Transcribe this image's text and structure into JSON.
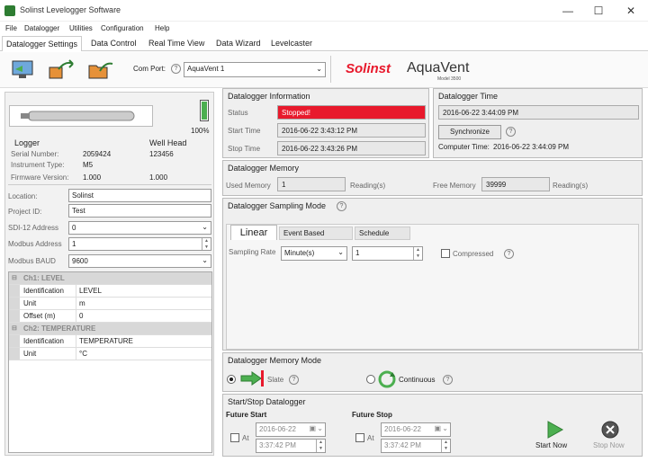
{
  "window": {
    "title": "Solinst Levelogger Software",
    "minimize": "—",
    "maximize": "☐",
    "close": "✕"
  },
  "menu": [
    "File",
    "Datalogger",
    "Utilities",
    "Configuration",
    "Help"
  ],
  "tabs": [
    "Datalogger Settings",
    "Data Control",
    "Real Time View",
    "Data Wizard",
    "Levelcaster"
  ],
  "toolbar": {
    "com_port_label": "Com Port:",
    "help": "?",
    "com_port_value": "AquaVent 1",
    "logo_solinst": "Solinst",
    "logo_aquavent": "AquaVent",
    "logo_sub": "Model 3500"
  },
  "device": {
    "battery_pct": "100%",
    "battery_level": 1.0
  },
  "logger": {
    "head_logger": "Logger",
    "head_well": "Well Head",
    "serial_label": "Serial Number:",
    "serial": "2059424",
    "serial_well": "123456",
    "instrument_label": "Instrument Type:",
    "instrument": "M5",
    "firmware_label": "Firmware Version:",
    "firmware": "1.000",
    "firmware_well": "1.000"
  },
  "fields": {
    "location_label": "Location:",
    "location": "Solinst",
    "project_label": "Project ID:",
    "project": "Test",
    "sdi_label": "SDI-12 Address",
    "sdi": "0",
    "modbus_label": "Modbus Address",
    "modbus": "1",
    "baud_label": "Modbus BAUD",
    "baud": "9600"
  },
  "channels": {
    "ch1": "Ch1: LEVEL",
    "ch1_rows": [
      [
        "Identification",
        "LEVEL"
      ],
      [
        "Unit",
        "m"
      ],
      [
        "Offset (m)",
        "0"
      ]
    ],
    "ch2": "Ch2: TEMPERATURE",
    "ch2_rows": [
      [
        "Identification",
        "TEMPERATURE"
      ],
      [
        "Unit",
        "°C"
      ]
    ]
  },
  "info": {
    "title": "Datalogger Information",
    "status_label": "Status",
    "status": "Stopped!",
    "status_color": "#e8192c",
    "start_label": "Start Time",
    "start": "2016-06-22 3:43:12 PM",
    "stop_label": "Stop Time",
    "stop": "2016-06-22 3:43:26 PM"
  },
  "time": {
    "title": "Datalogger Time",
    "value": "2016-06-22 3:44:09 PM",
    "sync": "Synchronize",
    "computer_label": "Computer Time:",
    "computer": "2016-06-22 3:44:09 PM"
  },
  "memory": {
    "title": "Datalogger Memory",
    "used_label": "Used Memory",
    "used": "1",
    "readings": "Reading(s)",
    "free_label": "Free Memory",
    "free": "39999"
  },
  "sampling": {
    "title": "Datalogger Sampling Mode",
    "tabs": [
      "Linear",
      "Event Based",
      "Schedule"
    ],
    "rate_label": "Sampling Rate",
    "rate_unit": "Minute(s)",
    "rate_value": "1",
    "compressed": "Compressed"
  },
  "memmode": {
    "title": "Datalogger Memory Mode",
    "slate": "Slate",
    "continuous": "Continuous"
  },
  "startstop": {
    "title": "Start/Stop Datalogger",
    "future_start": "Future Start",
    "future_stop": "Future Stop",
    "at": "At",
    "date": "2016-06-22",
    "time": "3:37:42 PM",
    "start_now": "Start Now",
    "stop_now": "Stop Now"
  }
}
